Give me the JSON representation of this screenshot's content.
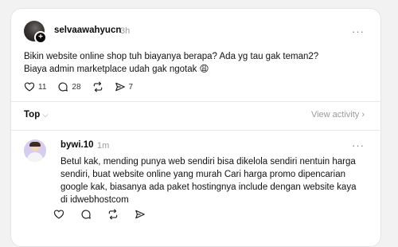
{
  "post": {
    "username": "selvaawahyucn",
    "time": "3h",
    "more": "···",
    "lines": [
      "Bikin website online shop tuh biayanya berapa? Ada yg tau gak teman2?",
      "Biaya admin marketplace udah gak ngotak 😩"
    ],
    "actions": {
      "likes": "11",
      "comments": "28",
      "shares": "7"
    }
  },
  "sort": {
    "label": "Top",
    "chevron": "⌵",
    "view_activity": "View activity ›"
  },
  "reply": {
    "username": "bywi.10",
    "time": "1m",
    "more": "···",
    "lines": [
      "Betul kak, mending punya web sendiri bisa dikelola sendiri nentuin harga",
      "sendiri, buat website online yang murah Cari harga promo dipencarian",
      "google kak, biasanya ada paket hostingnya include dengan website kaya",
      "di idwebhostcom"
    ]
  },
  "icons": {
    "like": "heart-icon",
    "comment": "comment-bubble-icon",
    "repost": "repost-icon",
    "share": "send-icon",
    "more": "more-dots-icon",
    "follow": "plus-icon"
  }
}
